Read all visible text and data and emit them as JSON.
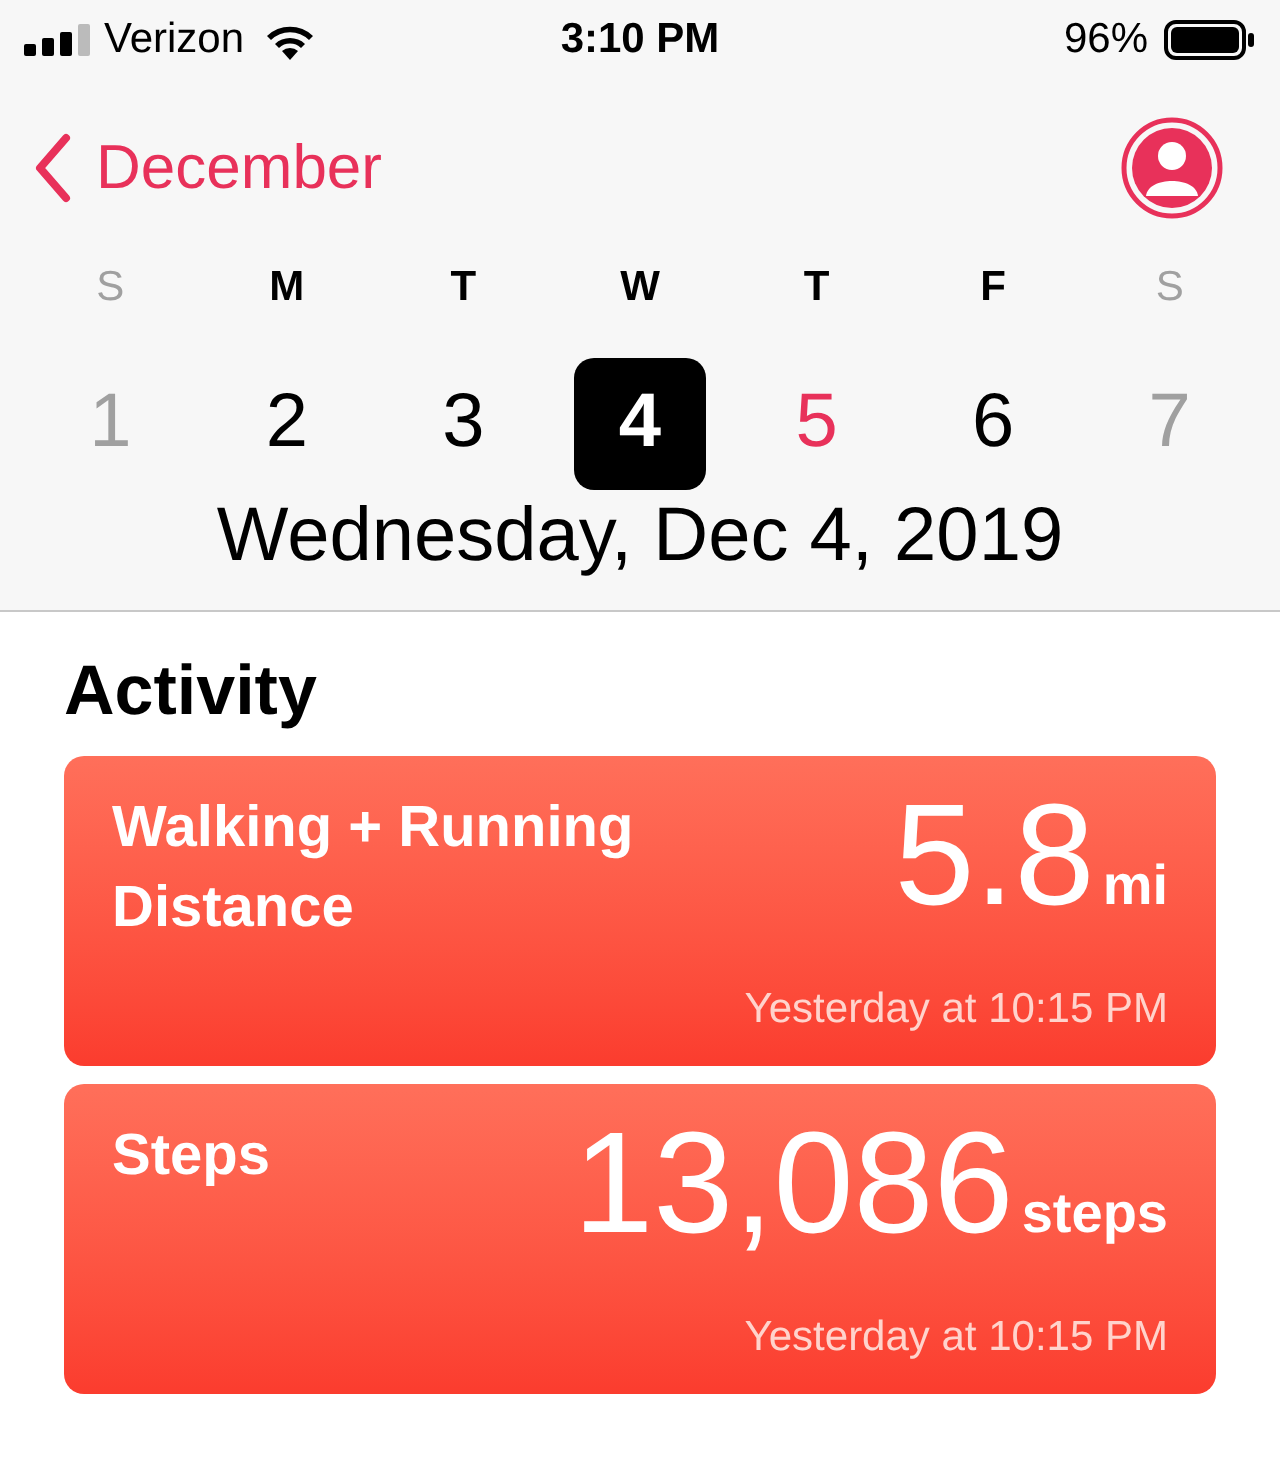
{
  "status_bar": {
    "carrier": "Verizon",
    "time": "3:10 PM",
    "battery": "96%"
  },
  "header": {
    "back_label": "December"
  },
  "days": [
    {
      "letter": "S",
      "number": "1",
      "weekend": true,
      "today": false,
      "selected": false
    },
    {
      "letter": "M",
      "number": "2",
      "weekend": false,
      "today": false,
      "selected": false
    },
    {
      "letter": "T",
      "number": "3",
      "weekend": false,
      "today": false,
      "selected": false
    },
    {
      "letter": "W",
      "number": "4",
      "weekend": false,
      "today": false,
      "selected": true
    },
    {
      "letter": "T",
      "number": "5",
      "weekend": false,
      "today": true,
      "selected": false
    },
    {
      "letter": "F",
      "number": "6",
      "weekend": false,
      "today": false,
      "selected": false
    },
    {
      "letter": "S",
      "number": "7",
      "weekend": true,
      "today": false,
      "selected": false
    }
  ],
  "date_title": "Wednesday, Dec 4, 2019",
  "section_title": "Activity",
  "cards": [
    {
      "title": "Walking + Running Distance",
      "value": "5.8",
      "unit": "mi",
      "time": "Yesterday at 10:15 PM"
    },
    {
      "title": "Steps",
      "value": "13,086",
      "unit": "steps",
      "time": "Yesterday at 10:15 PM"
    }
  ]
}
